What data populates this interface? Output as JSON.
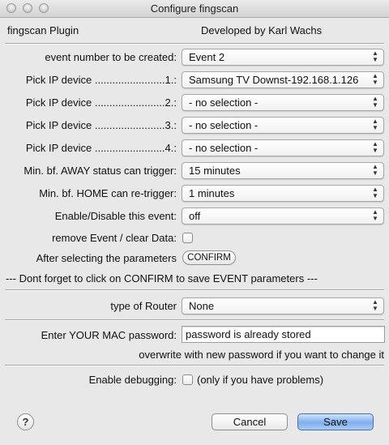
{
  "window": {
    "title": "Configure fingscan"
  },
  "header": {
    "plugin_name": "fingscan Plugin",
    "developer": "Developed by Karl Wachs"
  },
  "rows": [
    {
      "label": "event number to be created:",
      "value": "Event 2"
    },
    {
      "label": "Pick IP device ........................1.:",
      "value": "Samsung TV Downst-192.168.1.126"
    },
    {
      "label": "Pick IP device ........................2.:",
      "value": "- no selection -"
    },
    {
      "label": "Pick IP device ........................3.:",
      "value": "- no selection -"
    },
    {
      "label": "Pick IP device ........................4.:",
      "value": "- no selection -"
    },
    {
      "label": "Min. bf. AWAY status can trigger:",
      "value": "15 minutes"
    },
    {
      "label": "Min. bf. HOME can re-trigger:",
      "value": "1 minutes"
    },
    {
      "label": "Enable/Disable this event:",
      "value": "off"
    }
  ],
  "remove_event": {
    "label": "remove Event / clear Data:",
    "checked": false
  },
  "after_selecting": {
    "label": "After selecting the parameters",
    "button": "CONFIRM"
  },
  "reminder": "---  Dont forget to click on CONFIRM to save EVENT parameters  ---",
  "router": {
    "label": "type of Router",
    "value": "None"
  },
  "mac_password": {
    "label": "Enter YOUR MAC password:",
    "value": "password is already stored",
    "hint": "overwrite with new password if you want to change it"
  },
  "debugging": {
    "label": "Enable debugging:",
    "suffix": "(only if you have problems)",
    "checked": false
  },
  "footer": {
    "help": "?",
    "cancel": "Cancel",
    "save": "Save"
  },
  "colors": {
    "save_button": "#8dbbf2",
    "background": "#e8e8e8"
  }
}
